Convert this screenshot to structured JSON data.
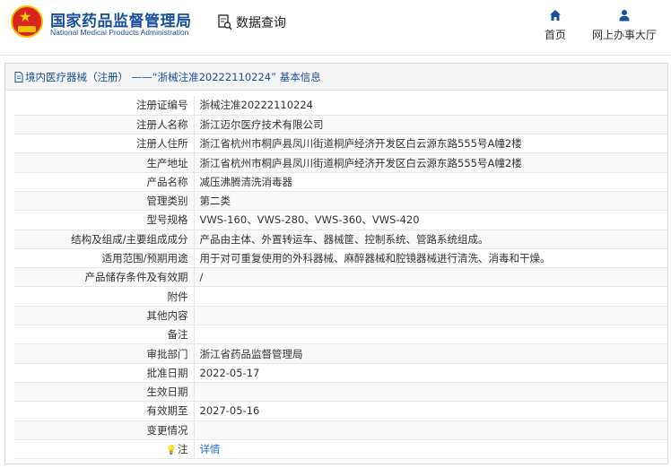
{
  "header": {
    "logo_cn": "国家药品监督管理局",
    "logo_en": "National Medical Products Administration",
    "query_label": "数据查询",
    "nav": [
      {
        "label": "首页",
        "icon": "home-icon"
      },
      {
        "label": "网上办事大厅",
        "icon": "user-icon"
      }
    ]
  },
  "panel": {
    "title": "境内医疗器械（注册） ——“浙械注准20222110224” 基本信息"
  },
  "rows": [
    {
      "label": "注册证编号",
      "value": "浙械注准20222110224"
    },
    {
      "label": "注册人名称",
      "value": "浙江迈尔医疗技术有限公司"
    },
    {
      "label": "注册人住所",
      "value": "浙江省杭州市桐庐县凤川街道桐庐经济开发区白云源东路555号A幢2楼"
    },
    {
      "label": "生产地址",
      "value": "浙江省杭州市桐庐县凤川街道桐庐经济开发区白云源东路555号A幢2楼"
    },
    {
      "label": "产品名称",
      "value": "减压沸腾清洗消毒器"
    },
    {
      "label": "管理类别",
      "value": "第二类"
    },
    {
      "label": "型号规格",
      "value": "VWS-160、VWS-280、VWS-360、VWS-420"
    },
    {
      "label": "结构及组成/主要组成成分",
      "value": "产品由主体、外置转运车、器械筐、控制系统、管路系统组成。"
    },
    {
      "label": "适用范围/预期用途",
      "value": "用于对可重复使用的外科器械、麻醉器械和腔镜器械进行清洗、消毒和干燥。"
    },
    {
      "label": "产品储存条件及有效期",
      "value": "/"
    },
    {
      "label": "附件",
      "value": ""
    },
    {
      "label": "其他内容",
      "value": ""
    },
    {
      "label": "备注",
      "value": ""
    },
    {
      "label": "审批部门",
      "value": "浙江省药品监督管理局"
    },
    {
      "label": "批准日期",
      "value": "2022-05-17"
    },
    {
      "label": "生效日期",
      "value": ""
    },
    {
      "label": "有效期至",
      "value": "2027-05-16"
    },
    {
      "label": "变更情况",
      "value": ""
    }
  ],
  "note_row": {
    "label": "注",
    "link": "详情",
    "icon": "bulb-icon"
  },
  "colors": {
    "brand_blue": "#1a4f9c",
    "link_blue": "#1e6fc8",
    "emblem_red": "#d9261c",
    "emblem_gold": "#f2c200"
  }
}
